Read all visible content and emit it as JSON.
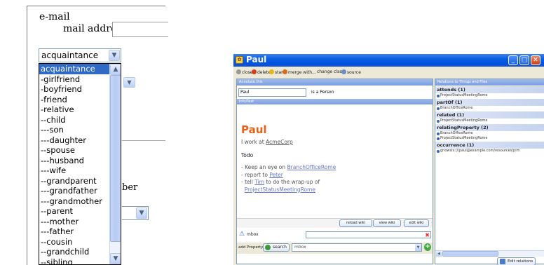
{
  "left": {
    "email_label": "e-mail",
    "mail_address_label": "mail address",
    "relation_select_value": "acquaintance",
    "dropdown_options": [
      "acquaintance",
      "-girlfriend",
      "-boyfriend",
      "-friend",
      "-relative",
      "--child",
      "---son",
      "---daughter",
      "--spouse",
      "---husband",
      "---wife",
      "--grandparent",
      "---grandfather",
      "---grandmother",
      "--parent",
      "---mother",
      "---father",
      "--cousin",
      "--grandchild",
      "--sibling"
    ],
    "selected_index": 0,
    "behind_text": "ber"
  },
  "app": {
    "title": "Paul",
    "toolbar": [
      {
        "label": "close",
        "icon": "close-icon",
        "color": "#999999"
      },
      {
        "label": "delete",
        "icon": "delete-icon",
        "color": "#d93b1c"
      },
      {
        "label": "star",
        "icon": "star-icon",
        "color": "#e8b41a"
      },
      {
        "label": "merge with...",
        "icon": "merge-icon",
        "color": "#d86a1b"
      },
      {
        "label": "change class",
        "icon": "",
        "color": ""
      },
      {
        "label": "source",
        "icon": "source-icon",
        "color": "#6b8cc7"
      }
    ],
    "main_header": "Annotate this",
    "name_value": "Paul",
    "is_a_text": "is a Person",
    "info_bar": "Info/Text",
    "wiki": {
      "heading": "Paul",
      "work_prefix": "I work at ",
      "work_link": "AcmeCorp",
      "todo": "Todo",
      "items": [
        {
          "prefix": "Keep an eye on ",
          "link": "BranchOfficeRome",
          "suffix": ""
        },
        {
          "prefix": "report to ",
          "link": "Peter",
          "suffix": ""
        },
        {
          "prefix": "tell ",
          "link": "Tim",
          "suffix": " to do the wrap-up of"
        },
        {
          "prefix": "",
          "link": "ProjectStatusMeetingRome",
          "suffix": ""
        }
      ]
    },
    "buttons": {
      "reload": "reload wiki",
      "view": "view wiki",
      "edit": "edit wiki"
    },
    "mbox_label": "mbox",
    "add_property_label": "add Property",
    "search_label": "search",
    "property_select_value": "mbox",
    "side_header": "Relations to Things and Files",
    "relations": [
      {
        "head": "attends (1)",
        "items": [
          "ProjectStatusMeetingRome"
        ]
      },
      {
        "head": "partOf (1)",
        "items": [
          "BranchOfficeRome"
        ]
      },
      {
        "head": "related (1)",
        "items": [
          "ProjectStatusMeetingRome"
        ]
      },
      {
        "head": "relatingProperty (2)",
        "items": [
          "BranchOfficeRome",
          "ProjectStatusMeetingRome"
        ]
      },
      {
        "head": "occurrence (1)",
        "items": [
          "gnowsis:///paul@example.com/resources/pim"
        ]
      }
    ],
    "edit_relations_label": "Edit relations",
    "colors": {
      "title_bar": "#0054e3",
      "heading": "#e8611a",
      "link": "#6677cc",
      "selection": "#316ac5"
    }
  }
}
